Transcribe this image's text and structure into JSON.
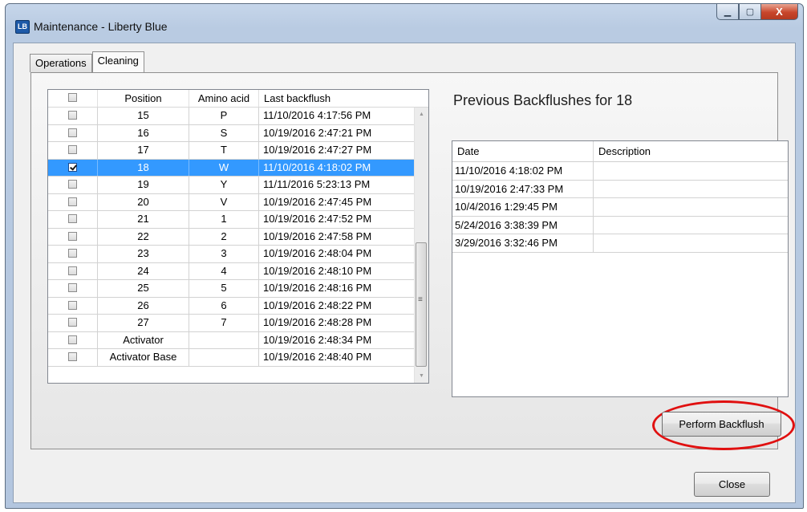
{
  "window": {
    "title": "Maintenance - Liberty Blue",
    "app_icon": "LB",
    "controls": {
      "minimize_icon": "minimize-icon",
      "maximize_icon": "maximize-icon",
      "close_icon": "close-icon",
      "minimize_glyph": "▁",
      "maximize_glyph": "▢",
      "close_glyph": "X"
    }
  },
  "tabs": [
    {
      "label": "Operations",
      "active": false
    },
    {
      "label": "Cleaning",
      "active": true
    }
  ],
  "positions_table": {
    "headers": [
      "",
      "Position",
      "Amino acid",
      "Last backflush"
    ],
    "rows": [
      {
        "checked": false,
        "position": "15",
        "amino_acid": "P",
        "last_backflush": "11/10/2016 4:17:56 PM"
      },
      {
        "checked": false,
        "position": "16",
        "amino_acid": "S",
        "last_backflush": "10/19/2016 2:47:21 PM"
      },
      {
        "checked": false,
        "position": "17",
        "amino_acid": "T",
        "last_backflush": "10/19/2016 2:47:27 PM"
      },
      {
        "checked": true,
        "position": "18",
        "amino_acid": "W",
        "last_backflush": "11/10/2016 4:18:02 PM",
        "selected": true
      },
      {
        "checked": false,
        "position": "19",
        "amino_acid": "Y",
        "last_backflush": "11/11/2016 5:23:13 PM"
      },
      {
        "checked": false,
        "position": "20",
        "amino_acid": "V",
        "last_backflush": "10/19/2016 2:47:45 PM"
      },
      {
        "checked": false,
        "position": "21",
        "amino_acid": "1",
        "last_backflush": "10/19/2016 2:47:52 PM"
      },
      {
        "checked": false,
        "position": "22",
        "amino_acid": "2",
        "last_backflush": "10/19/2016 2:47:58 PM"
      },
      {
        "checked": false,
        "position": "23",
        "amino_acid": "3",
        "last_backflush": "10/19/2016 2:48:04 PM"
      },
      {
        "checked": false,
        "position": "24",
        "amino_acid": "4",
        "last_backflush": "10/19/2016 2:48:10 PM"
      },
      {
        "checked": false,
        "position": "25",
        "amino_acid": "5",
        "last_backflush": "10/19/2016 2:48:16 PM"
      },
      {
        "checked": false,
        "position": "26",
        "amino_acid": "6",
        "last_backflush": "10/19/2016 2:48:22 PM"
      },
      {
        "checked": false,
        "position": "27",
        "amino_acid": "7",
        "last_backflush": "10/19/2016 2:48:28 PM"
      },
      {
        "checked": false,
        "position": "Activator",
        "amino_acid": "",
        "last_backflush": "10/19/2016 2:48:34 PM"
      },
      {
        "checked": false,
        "position": "Activator Base",
        "amino_acid": "",
        "last_backflush": "10/19/2016 2:48:40 PM"
      }
    ]
  },
  "history": {
    "title": "Previous Backflushes for 18",
    "headers": [
      "Date",
      "Description"
    ],
    "rows": [
      {
        "date": "11/10/2016 4:18:02 PM",
        "description": ""
      },
      {
        "date": "10/19/2016 2:47:33 PM",
        "description": ""
      },
      {
        "date": "10/4/2016 1:29:45 PM",
        "description": ""
      },
      {
        "date": "5/24/2016 3:38:39 PM",
        "description": ""
      },
      {
        "date": "3/29/2016 3:32:46 PM",
        "description": ""
      }
    ]
  },
  "buttons": {
    "perform_backflush": "Perform Backflush",
    "close": "Close"
  },
  "colors": {
    "selection": "#3399ff",
    "highlight_ring": "#e01010"
  }
}
